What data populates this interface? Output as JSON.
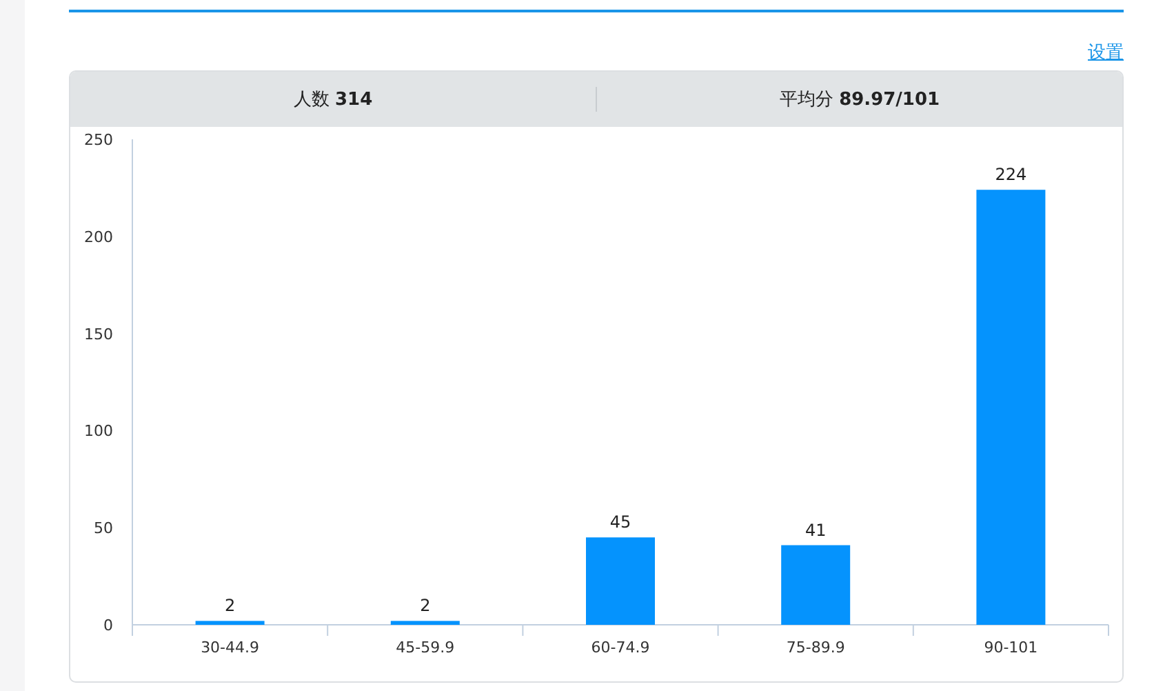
{
  "settings_link": "设置",
  "stats": [
    {
      "text": "人数 **314**"
    },
    {
      "text": "平均分 **89.97/101**"
    }
  ],
  "chart_data": {
    "type": "bar",
    "categories": [
      "30-44.9",
      "45-59.9",
      "60-74.9",
      "75-89.9",
      "90-101"
    ],
    "series": [
      {
        "color": "#0593fd",
        "values": [
          2,
          2,
          45,
          41,
          224
        ]
      }
    ],
    "ylim": [
      0,
      250
    ],
    "yticks": [
      0,
      50,
      100,
      150,
      200,
      250
    ],
    "data_labels": true
  }
}
